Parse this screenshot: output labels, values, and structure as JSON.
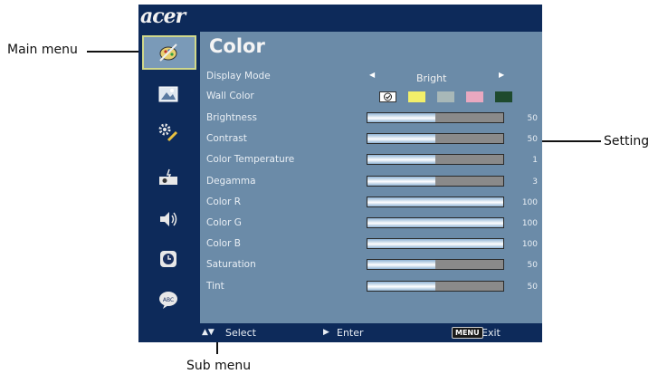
{
  "callouts": {
    "main_menu": "Main menu",
    "setting": "Setting",
    "sub_menu": "Sub menu"
  },
  "osd": {
    "brand": "acer",
    "title": "Color",
    "sidebar_icons": [
      "color-icon",
      "image-icon",
      "settings-icon",
      "projector-icon",
      "volume-icon",
      "timer-icon",
      "language-icon"
    ],
    "display_mode": {
      "label": "Display Mode",
      "value": "Bright"
    },
    "wall_color": {
      "label": "Wall Color",
      "swatches": [
        "#ffffff",
        "#f2ef6a",
        "#a8b8b8",
        "#e9a8c0",
        "#1e4a2e"
      ],
      "selected_index": 0
    },
    "settings": [
      {
        "label": "Brightness",
        "value": "50",
        "level": 0.5
      },
      {
        "label": "Contrast",
        "value": "50",
        "level": 0.5
      },
      {
        "label": "Color Temperature",
        "value": "1",
        "level": 0.5
      },
      {
        "label": "Degamma",
        "value": "3",
        "level": 0.5
      },
      {
        "label": "Color R",
        "value": "100",
        "level": 1.0
      },
      {
        "label": "Color G",
        "value": "100",
        "level": 1.0
      },
      {
        "label": "Color B",
        "value": "100",
        "level": 1.0
      },
      {
        "label": "Saturation",
        "value": "50",
        "level": 0.5
      },
      {
        "label": "Tint",
        "value": "50",
        "level": 0.5
      }
    ],
    "footer": {
      "select": "Select",
      "enter": "Enter",
      "menu_key": "MENU",
      "exit": "Exit"
    }
  },
  "colors": {
    "frame": "#0d2a5a",
    "panel": "#6b8ba8",
    "highlight_border": "#d0d88a"
  }
}
